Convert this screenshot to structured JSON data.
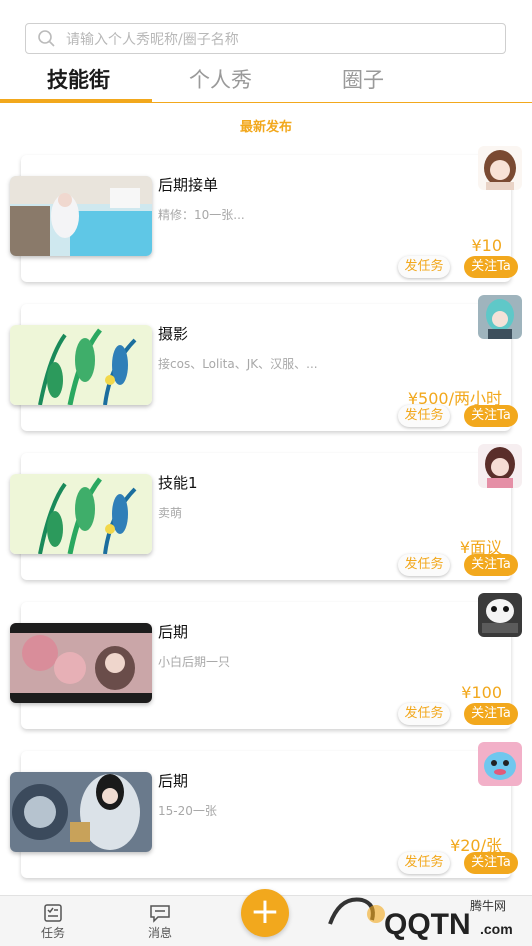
{
  "search": {
    "placeholder": "请输入个人秀昵称/圈子名称"
  },
  "tabs": [
    {
      "label": "技能街",
      "active": true
    },
    {
      "label": "个人秀",
      "active": false
    },
    {
      "label": "圈子",
      "active": false
    }
  ],
  "section_title": "最新发布",
  "cards": [
    {
      "title": "后期接单",
      "desc": "精修：10一张...",
      "price": "¥10",
      "task_label": "发任务",
      "follow_label": "关注Ta"
    },
    {
      "title": "摄影",
      "desc": "接cos、Lolita、JK、汉服、...",
      "price": "¥500/两小时",
      "task_label": "发任务",
      "follow_label": "关注Ta"
    },
    {
      "title": "技能1",
      "desc": "卖萌",
      "price": "¥面议",
      "task_label": "发任务",
      "follow_label": "关注Ta"
    },
    {
      "title": "后期",
      "desc": "小白后期一只",
      "price": "¥100",
      "task_label": "发任务",
      "follow_label": "关注Ta"
    },
    {
      "title": "后期",
      "desc": "15-20一张",
      "price": "¥20/张",
      "task_label": "发任务",
      "follow_label": "关注Ta"
    }
  ],
  "bottom_nav": {
    "items": [
      {
        "label": "任务",
        "icon": "task-list-icon"
      },
      {
        "label": "消息",
        "icon": "message-icon"
      }
    ],
    "fab_label": "+"
  },
  "watermark": {
    "text": "QQTN.com",
    "sub": "腾牛网"
  },
  "colors": {
    "accent": "#f2a81d"
  }
}
